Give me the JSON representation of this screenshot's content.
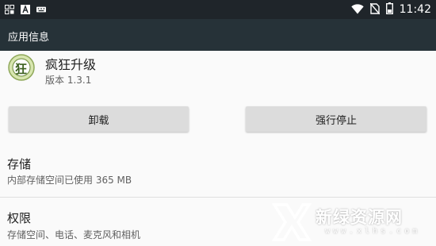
{
  "status_bar": {
    "time": "11:42",
    "left_icons": [
      "grid-notification-icon",
      "font-notification-icon",
      "keyboard-notification-icon"
    ],
    "right_icons": [
      "wifi-icon",
      "no-sim-icon",
      "battery-icon"
    ]
  },
  "app_bar": {
    "title": "应用信息"
  },
  "app": {
    "name": "疯狂升级",
    "version": "版本 1.3.1",
    "icon_char": "狂"
  },
  "buttons": {
    "uninstall": "卸载",
    "force_stop": "强行停止"
  },
  "storage": {
    "title": "存储",
    "summary": "内部存储空间已使用 365 MB"
  },
  "permissions": {
    "title": "权限",
    "summary": "存储空间、电话、麦克风和相机"
  },
  "watermark": {
    "name": "新绿资源网",
    "url": "www.xlhs.com"
  },
  "colors": {
    "status_bar": "#1f252a",
    "app_bar": "#263238",
    "background": "#fafafa",
    "button": "#dcdcdc"
  }
}
